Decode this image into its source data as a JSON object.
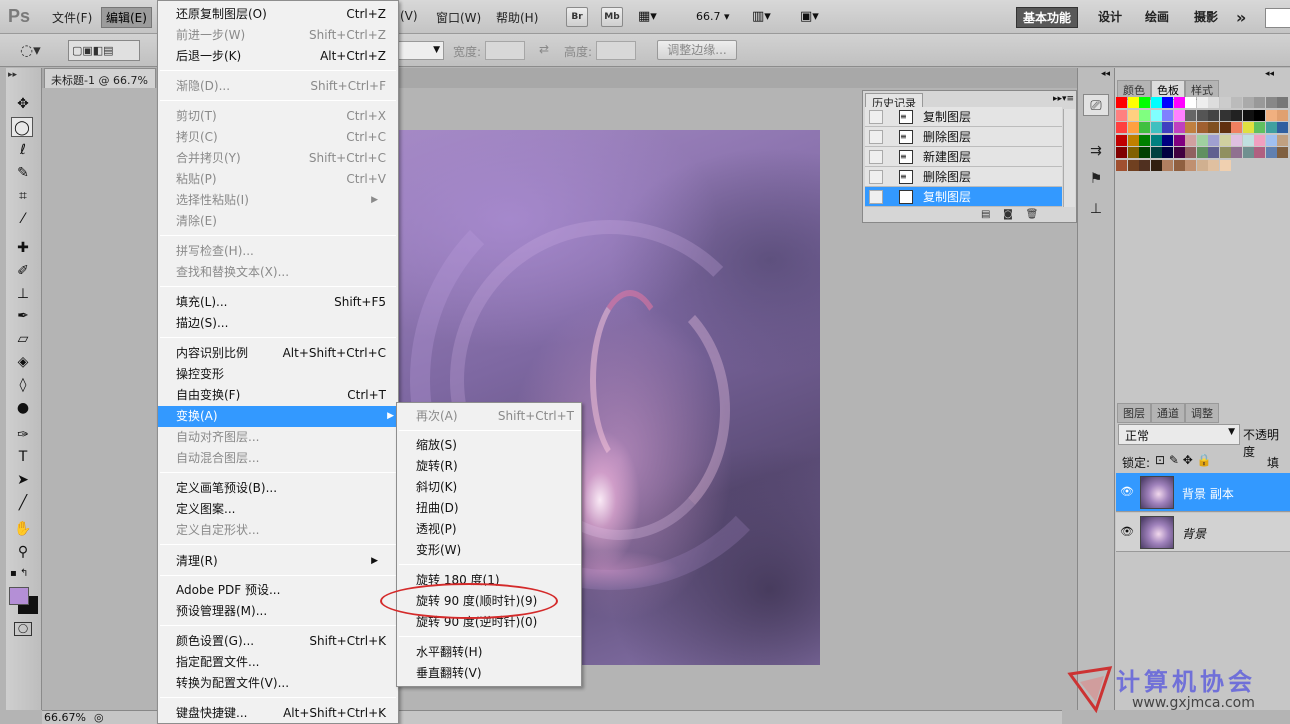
{
  "menubar": {
    "logo": "Ps",
    "items": [
      "文件(F)",
      "编辑(E)",
      "(V)",
      "窗口(W)",
      "帮助(H)"
    ],
    "bridge": "Br",
    "minibridge": "Mb",
    "zoom": "66.7",
    "workspaces": [
      "基本功能",
      "设计",
      "绘画",
      "摄影"
    ],
    "more": "»"
  },
  "options": {
    "width_label": "宽度:",
    "height_label": "高度:",
    "refine_edge": "调整边缘..."
  },
  "doc_tab": "未标题-1 @ 66.7%",
  "edit_menu": {
    "items": [
      {
        "label": "还原复制图层(O)",
        "shortcut": "Ctrl+Z"
      },
      {
        "label": "前进一步(W)",
        "shortcut": "Shift+Ctrl+Z"
      },
      {
        "label": "后退一步(K)",
        "shortcut": "Alt+Ctrl+Z"
      },
      {
        "label": "渐隐(D)...",
        "shortcut": "Shift+Ctrl+F"
      },
      {
        "label": "剪切(T)",
        "shortcut": "Ctrl+X"
      },
      {
        "label": "拷贝(C)",
        "shortcut": "Ctrl+C"
      },
      {
        "label": "合并拷贝(Y)",
        "shortcut": "Shift+Ctrl+C"
      },
      {
        "label": "粘贴(P)",
        "shortcut": "Ctrl+V"
      },
      {
        "label": "选择性粘贴(I)",
        "shortcut": ""
      },
      {
        "label": "清除(E)",
        "shortcut": ""
      },
      {
        "label": "拼写检查(H)...",
        "shortcut": ""
      },
      {
        "label": "查找和替换文本(X)...",
        "shortcut": ""
      },
      {
        "label": "填充(L)...",
        "shortcut": "Shift+F5"
      },
      {
        "label": "描边(S)...",
        "shortcut": ""
      },
      {
        "label": "内容识别比例",
        "shortcut": "Alt+Shift+Ctrl+C"
      },
      {
        "label": "操控变形",
        "shortcut": ""
      },
      {
        "label": "自由变换(F)",
        "shortcut": "Ctrl+T"
      },
      {
        "label": "变换(A)",
        "shortcut": ""
      },
      {
        "label": "自动对齐图层...",
        "shortcut": ""
      },
      {
        "label": "自动混合图层...",
        "shortcut": ""
      },
      {
        "label": "定义画笔预设(B)...",
        "shortcut": ""
      },
      {
        "label": "定义图案...",
        "shortcut": ""
      },
      {
        "label": "定义自定形状...",
        "shortcut": ""
      },
      {
        "label": "清理(R)",
        "shortcut": ""
      },
      {
        "label": "Adobe PDF 预设...",
        "shortcut": ""
      },
      {
        "label": "预设管理器(M)...",
        "shortcut": ""
      },
      {
        "label": "颜色设置(G)...",
        "shortcut": "Shift+Ctrl+K"
      },
      {
        "label": "指定配置文件...",
        "shortcut": ""
      },
      {
        "label": "转换为配置文件(V)...",
        "shortcut": ""
      },
      {
        "label": "键盘快捷键...",
        "shortcut": "Alt+Shift+Ctrl+K"
      }
    ]
  },
  "transform_menu": {
    "items": [
      {
        "label": "再次(A)",
        "shortcut": "Shift+Ctrl+T"
      },
      {
        "label": "缩放(S)",
        "shortcut": ""
      },
      {
        "label": "旋转(R)",
        "shortcut": ""
      },
      {
        "label": "斜切(K)",
        "shortcut": ""
      },
      {
        "label": "扭曲(D)",
        "shortcut": ""
      },
      {
        "label": "透视(P)",
        "shortcut": ""
      },
      {
        "label": "变形(W)",
        "shortcut": ""
      },
      {
        "label": "旋转 180 度(1)",
        "shortcut": ""
      },
      {
        "label": "旋转 90 度(顺时针)(9)",
        "shortcut": ""
      },
      {
        "label": "旋转 90 度(逆时针)(0)",
        "shortcut": ""
      },
      {
        "label": "水平翻转(H)",
        "shortcut": ""
      },
      {
        "label": "垂直翻转(V)",
        "shortcut": ""
      }
    ]
  },
  "history": {
    "tab": "历史记录",
    "rows": [
      "复制图层",
      "删除图层",
      "新建图层",
      "删除图层",
      "复制图层"
    ]
  },
  "color_panel": {
    "tabs": [
      "颜色",
      "色板",
      "样式"
    ]
  },
  "layers": {
    "tabs": [
      "图层",
      "通道",
      "调整"
    ],
    "blend_mode": "正常",
    "opacity_label": "不透明度",
    "lock_label": "锁定:",
    "fill_label": "填充",
    "rows": [
      "背景 副本",
      "背景"
    ]
  },
  "status": {
    "zoom": "66.67%"
  },
  "watermark": {
    "text": "计算机协会",
    "url": "www.gxjmca.com"
  },
  "colors": {
    "highlight": "#3399ff",
    "annotation": "#d42a2a",
    "foreground": "#b48fd6"
  }
}
